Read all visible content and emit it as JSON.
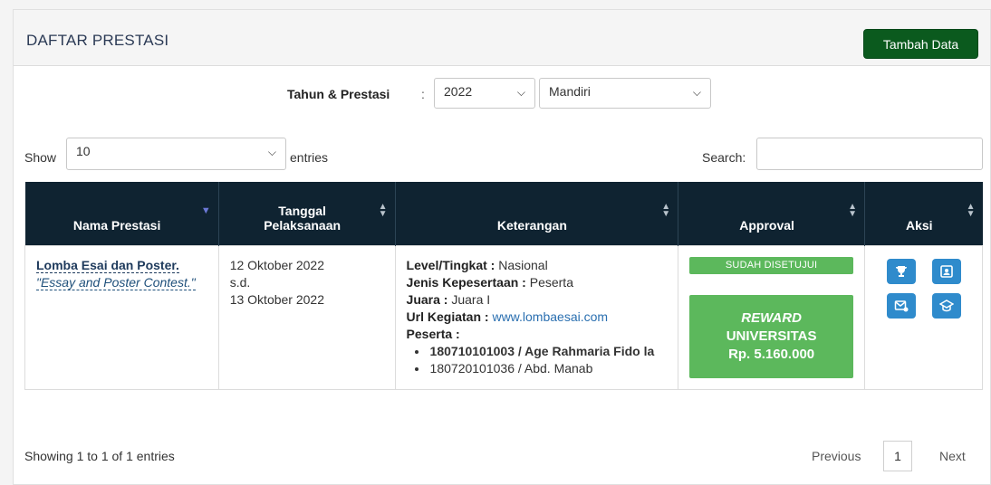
{
  "header": {
    "title": "DAFTAR PRESTASI",
    "add_button": "Tambah Data"
  },
  "filter": {
    "label": "Tahun & Prestasi",
    "colon": ":",
    "year_value": "2022",
    "type_value": "Mandiri"
  },
  "length": {
    "show_label": "Show",
    "value": "10",
    "entries_label": "entries"
  },
  "search": {
    "label": "Search:",
    "value": ""
  },
  "table": {
    "columns": [
      "Nama Prestasi",
      "Tanggal Pelaksanaan",
      "Keterangan",
      "Approval",
      "Aksi"
    ],
    "rows": [
      {
        "nama": "Lomba Esai dan Poster.",
        "nama_en": "\"Essay and Poster Contest.\"",
        "tanggal_mulai": "12 Oktober 2022",
        "sd": "s.d.",
        "tanggal_selesai": "13 Oktober 2022",
        "level_label": "Level/Tingkat :",
        "level": "Nasional",
        "jenis_label": "Jenis Kepesertaan :",
        "jenis": "Peserta",
        "juara_label": "Juara :",
        "juara": "Juara I",
        "url_label": "Url Kegiatan :",
        "url": "www.lombaesai.com",
        "peserta_label": "Peserta :",
        "peserta": [
          "180710101003 / Age Rahmaria Fido la",
          "180720101036 / Abd. Manab"
        ],
        "approval_status": "SUDAH DISETUJUI",
        "reward_line1": "REWARD",
        "reward_line2": "UNIVERSITAS",
        "reward_line3": "Rp. 5.160.000"
      }
    ]
  },
  "actions": [
    "trophy-icon",
    "id-card-icon",
    "mail-icon",
    "graduation-cap-icon"
  ],
  "footer": {
    "info": "Showing 1 to 1 of 1 entries",
    "previous": "Previous",
    "page": "1",
    "next": "Next"
  },
  "colors": {
    "header_dark": "#0f2331",
    "add_button": "#0b5a1e",
    "approve_green": "#5cb85c",
    "action_blue": "#2f8bcc"
  }
}
